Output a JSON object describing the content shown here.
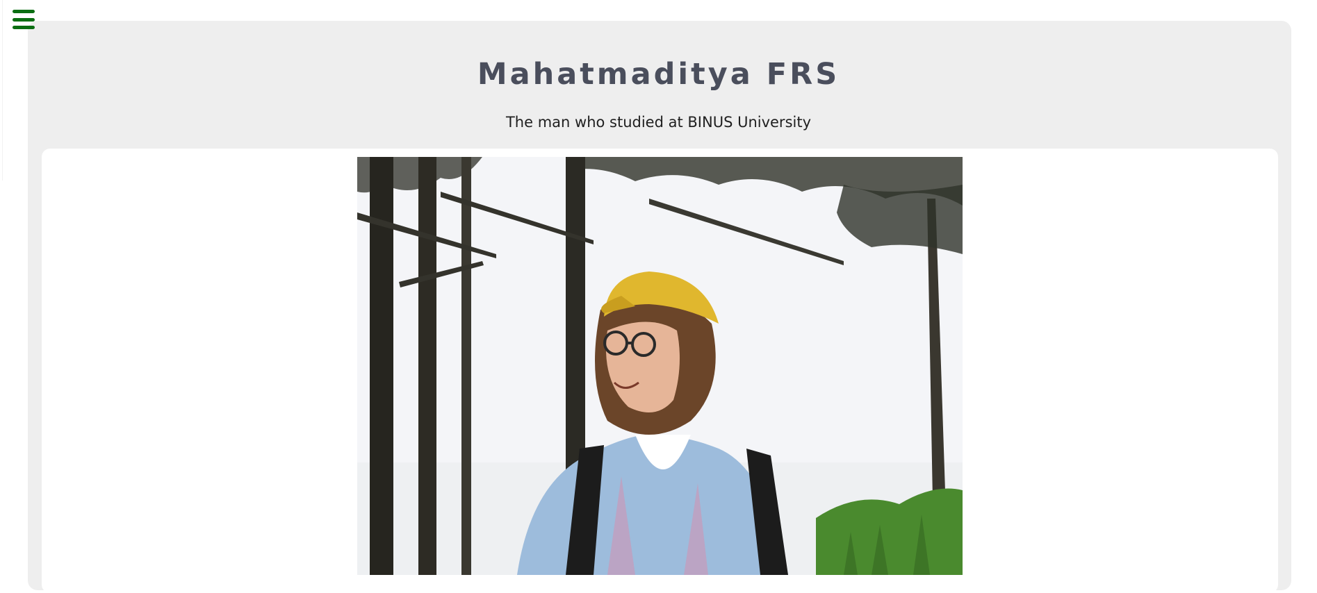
{
  "header": {
    "menu_icon": "hamburger-menu-icon",
    "accent_color": "#0b6e12"
  },
  "profile": {
    "name": "Mahatmaditya FRS",
    "tagline": "The man who studied at BINUS University"
  },
  "photo": {
    "subject": "portrait-photo",
    "colors": {
      "sky": "#f4f5f8",
      "trees": "#2b2a25",
      "cap": "#e0b72e",
      "hoodie": "#9dbcdc",
      "grass": "#4a8a2e"
    }
  }
}
